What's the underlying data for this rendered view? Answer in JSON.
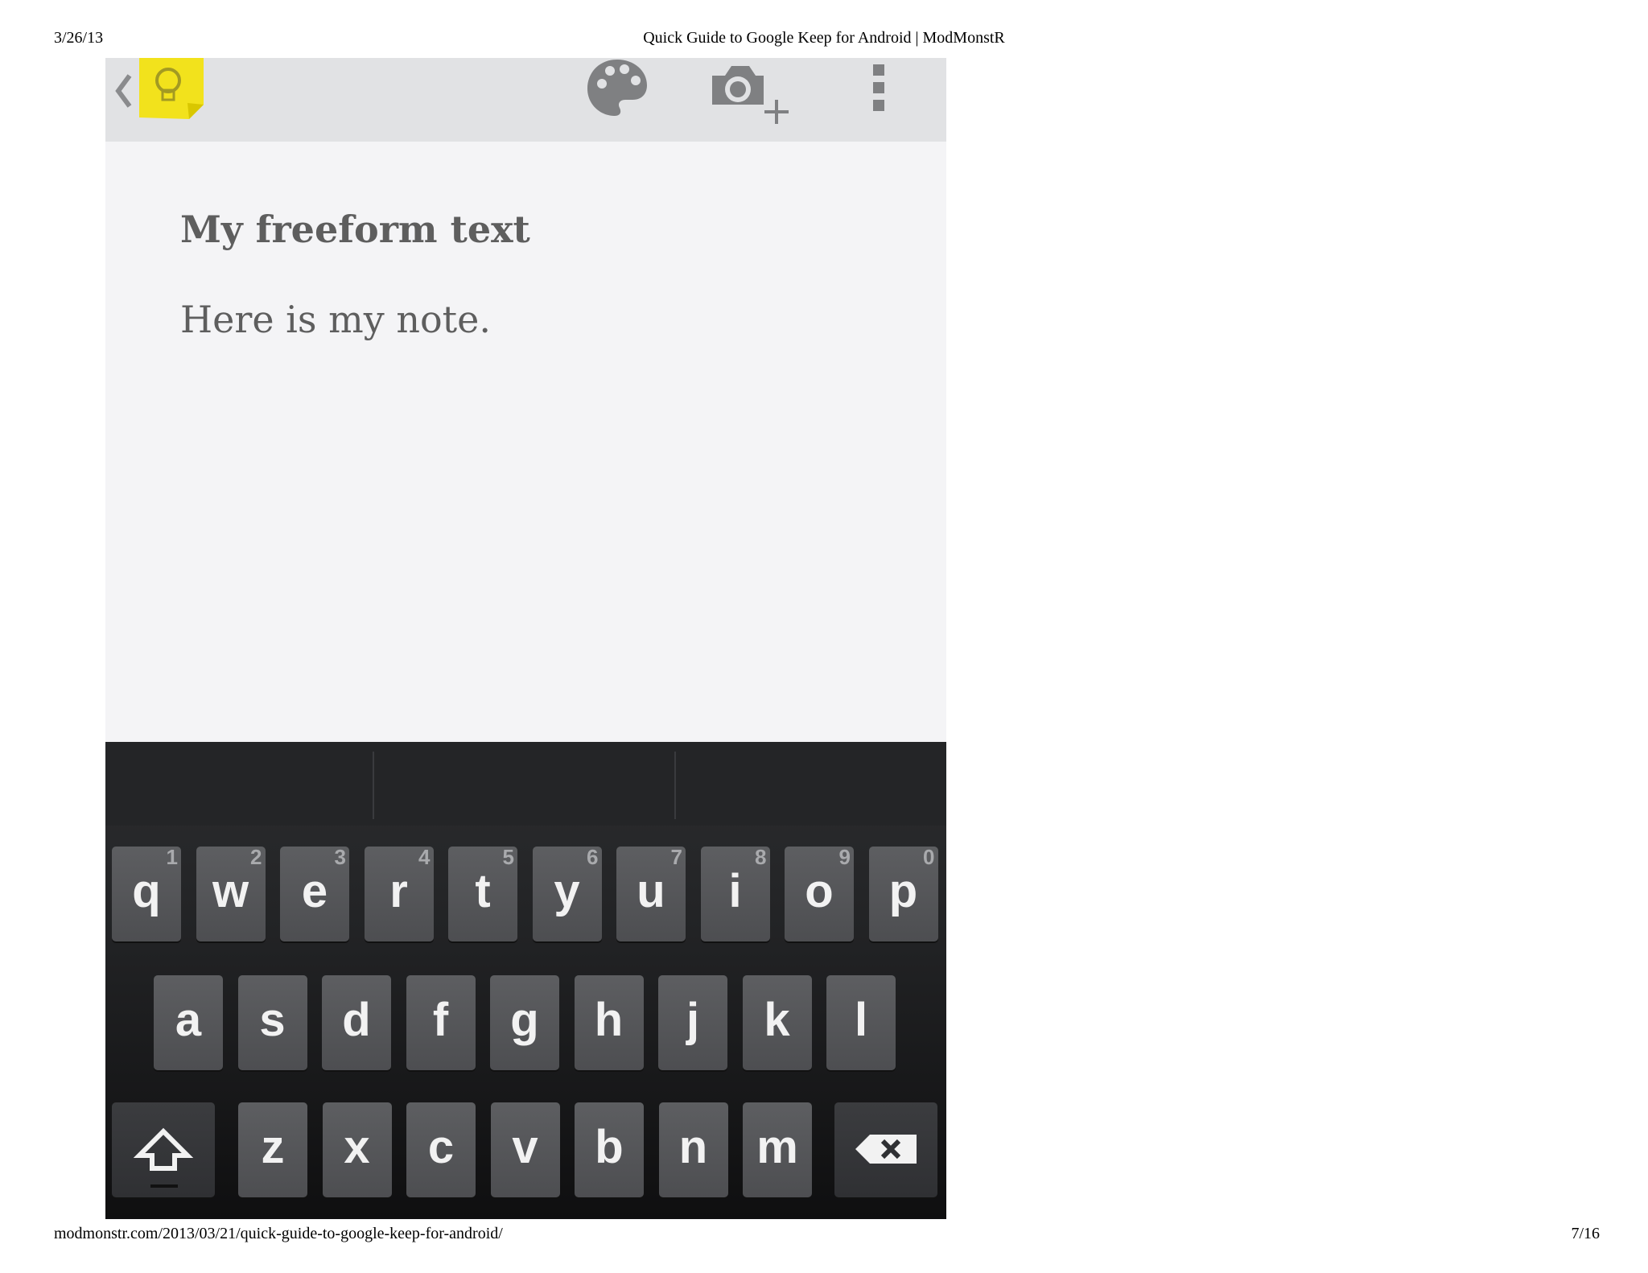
{
  "print_header": {
    "date": "3/26/13",
    "title": "Quick Guide to Google Keep for Android | ModMonstR"
  },
  "print_footer": {
    "url": "modmonstr.com/2013/03/21/quick-guide-to-google-keep-for-android/",
    "page": "7/16"
  },
  "action_bar": {
    "icons": [
      "up-caret-icon",
      "keep-logo-icon",
      "palette-icon",
      "camera-add-icon",
      "overflow-menu-icon"
    ],
    "colors": {
      "background": "#e1e2e4",
      "icon": "#7f8082",
      "logo": "#f2e21c"
    }
  },
  "note": {
    "title": "My freeform text",
    "body": "Here is my note."
  },
  "keyboard": {
    "row1": [
      {
        "k": "q",
        "h": "1"
      },
      {
        "k": "w",
        "h": "2"
      },
      {
        "k": "e",
        "h": "3"
      },
      {
        "k": "r",
        "h": "4"
      },
      {
        "k": "t",
        "h": "5"
      },
      {
        "k": "y",
        "h": "6"
      },
      {
        "k": "u",
        "h": "7"
      },
      {
        "k": "i",
        "h": "8"
      },
      {
        "k": "o",
        "h": "9"
      },
      {
        "k": "p",
        "h": "0"
      }
    ],
    "row2": [
      "a",
      "s",
      "d",
      "f",
      "g",
      "h",
      "j",
      "k",
      "l"
    ],
    "row3": [
      "z",
      "x",
      "c",
      "v",
      "b",
      "n",
      "m"
    ],
    "shift_icon": "shift-arrow-icon",
    "backspace_icon": "backspace-icon"
  }
}
